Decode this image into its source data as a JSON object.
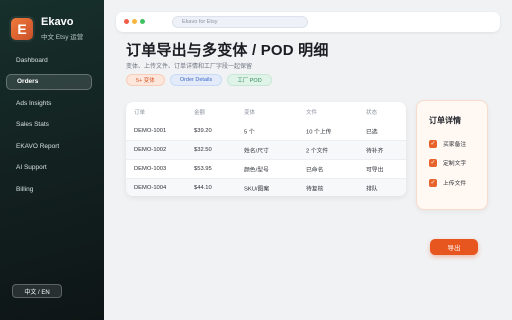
{
  "brand": {
    "logo_letter": "E",
    "name": "Ekavo",
    "subtitle": "中文 Etsy 运营"
  },
  "sidebar": {
    "items": [
      {
        "label": "Dashboard",
        "active": false
      },
      {
        "label": "Orders",
        "active": true
      },
      {
        "label": "Ads Insights",
        "active": false
      },
      {
        "label": "Sales Stats",
        "active": false
      },
      {
        "label": "EKAVO Report",
        "active": false
      },
      {
        "label": "AI Support",
        "active": false
      },
      {
        "label": "Billing",
        "active": false
      }
    ],
    "language_toggle": "中文 / EN"
  },
  "browser": {
    "url": "Ekavo for Etsy"
  },
  "page": {
    "title": "订单导出与多变体 / POD 明细",
    "subtitle": "变体、上传文件、订单详情和工厂字段一起保留",
    "tags": [
      "5+ 变体",
      "Order Details",
      "工厂 POD"
    ]
  },
  "table": {
    "headers": [
      "订单",
      "金额",
      "变体",
      "文件",
      "状态"
    ],
    "rows": [
      [
        "DEMO-1001",
        "$39.20",
        "5 个",
        "10 个上传",
        "已选"
      ],
      [
        "DEMO-1002",
        "$32.50",
        "姓名/尺寸",
        "2 个文件",
        "待补齐"
      ],
      [
        "DEMO-1003",
        "$53.95",
        "颜色/型号",
        "已命名",
        "可导出"
      ],
      [
        "DEMO-1004",
        "$44.10",
        "SKU/图案",
        "待复核",
        "排队"
      ]
    ]
  },
  "details": {
    "title": "订单详情",
    "items": [
      "买家备注",
      "定制文字",
      "上传文件"
    ]
  },
  "export_button": "导出",
  "colors": {
    "accent": "#e8561f",
    "sidebar_bg": "#12201f"
  }
}
